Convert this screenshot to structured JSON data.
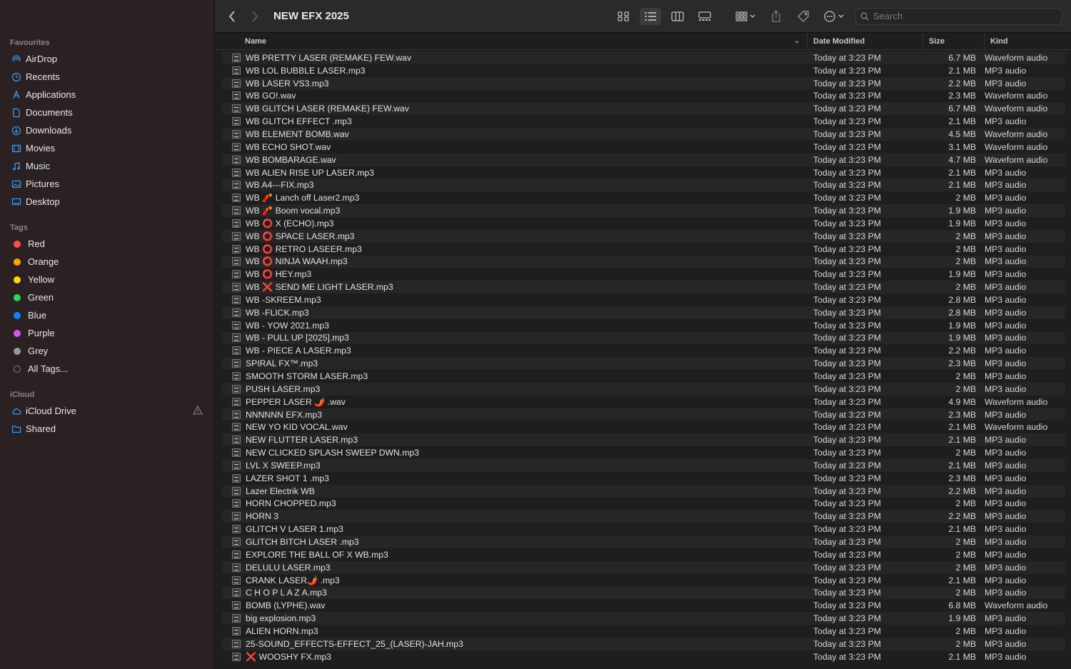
{
  "sidebar": {
    "favourites_label": "Favourites",
    "favourites": [
      {
        "label": "AirDrop",
        "icon": "airdrop-icon"
      },
      {
        "label": "Recents",
        "icon": "clock-icon"
      },
      {
        "label": "Applications",
        "icon": "applications-icon"
      },
      {
        "label": "Documents",
        "icon": "document-icon"
      },
      {
        "label": "Downloads",
        "icon": "download-icon"
      },
      {
        "label": "Movies",
        "icon": "film-icon"
      },
      {
        "label": "Music",
        "icon": "music-note-icon"
      },
      {
        "label": "Pictures",
        "icon": "picture-icon"
      },
      {
        "label": "Desktop",
        "icon": "desktop-icon"
      }
    ],
    "tags_label": "Tags",
    "tags": [
      {
        "label": "Red",
        "color": "#ff4d4d"
      },
      {
        "label": "Orange",
        "color": "#ff9f0a"
      },
      {
        "label": "Yellow",
        "color": "#ffd60a"
      },
      {
        "label": "Green",
        "color": "#30d158"
      },
      {
        "label": "Blue",
        "color": "#0a84ff"
      },
      {
        "label": "Purple",
        "color": "#d554f0"
      },
      {
        "label": "Grey",
        "color": "#98989d"
      },
      {
        "label": "All Tags...",
        "color": ""
      }
    ],
    "icloud_label": "iCloud",
    "icloud": [
      {
        "label": "iCloud Drive",
        "icon": "cloud-icon"
      },
      {
        "label": "Shared",
        "icon": "shared-folder-icon"
      }
    ],
    "accent_color": "#3b9cf5"
  },
  "toolbar": {
    "title": "NEW EFX 2025",
    "search_placeholder": "Search"
  },
  "table": {
    "headers": {
      "name": "Name",
      "date": "Date Modified",
      "size": "Size",
      "kind": "Kind"
    },
    "rows": [
      {
        "name": "WB PRETTY  LASER (REMAKE) FEW.wav",
        "date": "Today at 3:23 PM",
        "size": "6.7 MB",
        "kind": "Waveform audio"
      },
      {
        "name": "WB LOL BUBBLE LASER.mp3",
        "date": "Today at 3:23 PM",
        "size": "2.1 MB",
        "kind": "MP3 audio"
      },
      {
        "name": "WB LASER VS3.mp3",
        "date": "Today at 3:23 PM",
        "size": "2.2 MB",
        "kind": "MP3 audio"
      },
      {
        "name": "WB GO!.wav",
        "date": "Today at 3:23 PM",
        "size": "2.3 MB",
        "kind": "Waveform audio"
      },
      {
        "name": "WB GLITCH LASER (REMAKE) FEW.wav",
        "date": "Today at 3:23 PM",
        "size": "6.7 MB",
        "kind": "Waveform audio"
      },
      {
        "name": "WB GLITCH EFFECT .mp3",
        "date": "Today at 3:23 PM",
        "size": "2.1 MB",
        "kind": "MP3 audio"
      },
      {
        "name": "WB ELEMENT BOMB.wav",
        "date": "Today at 3:23 PM",
        "size": "4.5 MB",
        "kind": "Waveform audio"
      },
      {
        "name": "WB ECHO SHOT.wav",
        "date": "Today at 3:23 PM",
        "size": "3.1 MB",
        "kind": "Waveform audio"
      },
      {
        "name": "WB BOMBARAGE.wav",
        "date": "Today at 3:23 PM",
        "size": "4.7 MB",
        "kind": "Waveform audio"
      },
      {
        "name": "WB ALIEN RISE UP LASER.mp3",
        "date": "Today at 3:23 PM",
        "size": "2.1 MB",
        "kind": "MP3 audio"
      },
      {
        "name": "WB A4---FIX.mp3",
        "date": "Today at 3:23 PM",
        "size": "2.1 MB",
        "kind": "MP3 audio"
      },
      {
        "name": "WB 🧨 Lanch off Laser2.mp3",
        "date": "Today at 3:23 PM",
        "size": "2 MB",
        "kind": "MP3 audio"
      },
      {
        "name": "WB 🧨 Boom vocal.mp3",
        "date": "Today at 3:23 PM",
        "size": "1.9 MB",
        "kind": "MP3 audio"
      },
      {
        "name": "WB ⭕ X (ECHO).mp3",
        "date": "Today at 3:23 PM",
        "size": "1.9 MB",
        "kind": "MP3 audio"
      },
      {
        "name": "WB ⭕ SPACE LASER.mp3",
        "date": "Today at 3:23 PM",
        "size": "2 MB",
        "kind": "MP3 audio"
      },
      {
        "name": "WB ⭕ RETRO LASEER.mp3",
        "date": "Today at 3:23 PM",
        "size": "2 MB",
        "kind": "MP3 audio"
      },
      {
        "name": "WB ⭕ NINJA WAAH.mp3",
        "date": "Today at 3:23 PM",
        "size": "2 MB",
        "kind": "MP3 audio"
      },
      {
        "name": "WB ⭕ HEY.mp3",
        "date": "Today at 3:23 PM",
        "size": "1.9 MB",
        "kind": "MP3 audio"
      },
      {
        "name": "WB ❌ SEND ME LIGHT LASER.mp3",
        "date": "Today at 3:23 PM",
        "size": "2 MB",
        "kind": "MP3 audio"
      },
      {
        "name": "WB -SKREEM.mp3",
        "date": "Today at 3:23 PM",
        "size": "2.8 MB",
        "kind": "MP3 audio"
      },
      {
        "name": "WB -FLICK.mp3",
        "date": "Today at 3:23 PM",
        "size": "2.8 MB",
        "kind": "MP3 audio"
      },
      {
        "name": "WB - YOW 2021.mp3",
        "date": "Today at 3:23 PM",
        "size": "1.9 MB",
        "kind": "MP3 audio"
      },
      {
        "name": "WB - PULL UP [2025].mp3",
        "date": "Today at 3:23 PM",
        "size": "1.9 MB",
        "kind": "MP3 audio"
      },
      {
        "name": "WB - PIECE A LASER.mp3",
        "date": "Today at 3:23 PM",
        "size": "2.2 MB",
        "kind": "MP3 audio"
      },
      {
        "name": "SPIRAL FX™.mp3",
        "date": "Today at 3:23 PM",
        "size": "2.3 MB",
        "kind": "MP3 audio"
      },
      {
        "name": "SMOOTH STORM LASER.mp3",
        "date": "Today at 3:23 PM",
        "size": "2 MB",
        "kind": "MP3 audio"
      },
      {
        "name": "PUSH LASER.mp3",
        "date": "Today at 3:23 PM",
        "size": "2 MB",
        "kind": "MP3 audio"
      },
      {
        "name": "PEPPER LASER 🌶️ .wav",
        "date": "Today at 3:23 PM",
        "size": "4.9 MB",
        "kind": "Waveform audio"
      },
      {
        "name": "NNNNNN EFX.mp3",
        "date": "Today at 3:23 PM",
        "size": "2.3 MB",
        "kind": "MP3 audio"
      },
      {
        "name": "NEW YO KID VOCAL.wav",
        "date": "Today at 3:23 PM",
        "size": "2.1 MB",
        "kind": "Waveform audio"
      },
      {
        "name": "NEW FLUTTER LASER.mp3",
        "date": "Today at 3:23 PM",
        "size": "2.1 MB",
        "kind": "MP3 audio"
      },
      {
        "name": "NEW CLICKED SPLASH SWEEP DWN.mp3",
        "date": "Today at 3:23 PM",
        "size": "2 MB",
        "kind": "MP3 audio"
      },
      {
        "name": "LVL X SWEEP.mp3",
        "date": "Today at 3:23 PM",
        "size": "2.1 MB",
        "kind": "MP3 audio"
      },
      {
        "name": "LAZER SHOT 1 .mp3",
        "date": "Today at 3:23 PM",
        "size": "2.3 MB",
        "kind": "MP3 audio"
      },
      {
        "name": "Lazer Electrik WB",
        "date": "Today at 3:23 PM",
        "size": "2.2 MB",
        "kind": "MP3 audio"
      },
      {
        "name": "HORN CHOPPED.mp3",
        "date": "Today at 3:23 PM",
        "size": "2 MB",
        "kind": "MP3 audio"
      },
      {
        "name": "HORN 3",
        "date": "Today at 3:23 PM",
        "size": "2.2 MB",
        "kind": "MP3 audio"
      },
      {
        "name": "GLITCH V LASER 1.mp3",
        "date": "Today at 3:23 PM",
        "size": "2.1 MB",
        "kind": "MP3 audio"
      },
      {
        "name": "GLITCH BITCH LASER .mp3",
        "date": "Today at 3:23 PM",
        "size": "2 MB",
        "kind": "MP3 audio"
      },
      {
        "name": "EXPLORE THE BALL OF X WB.mp3",
        "date": "Today at 3:23 PM",
        "size": "2 MB",
        "kind": "MP3 audio"
      },
      {
        "name": "DELULU LASER.mp3",
        "date": "Today at 3:23 PM",
        "size": "2 MB",
        "kind": "MP3 audio"
      },
      {
        "name": "CRANK LASER🌶️ .mp3",
        "date": "Today at 3:23 PM",
        "size": "2.1 MB",
        "kind": "MP3 audio"
      },
      {
        "name": "C H O P L A Z A.mp3",
        "date": "Today at 3:23 PM",
        "size": "2 MB",
        "kind": "MP3 audio"
      },
      {
        "name": "BOMB (LYPHE).wav",
        "date": "Today at 3:23 PM",
        "size": "6.8 MB",
        "kind": "Waveform audio"
      },
      {
        "name": "big explosion.mp3",
        "date": "Today at 3:23 PM",
        "size": "1.9 MB",
        "kind": "MP3 audio"
      },
      {
        "name": "ALIEN HORN.mp3",
        "date": "Today at 3:23 PM",
        "size": "2 MB",
        "kind": "MP3 audio"
      },
      {
        "name": "25-SOUND_EFFECTS-EFFECT_25_(LASER)-JAH.mp3",
        "date": "Today at 3:23 PM",
        "size": "2 MB",
        "kind": "MP3 audio"
      },
      {
        "name": "❌ WOOSHY FX.mp3",
        "date": "Today at 3:23 PM",
        "size": "2.1 MB",
        "kind": "MP3 audio"
      }
    ]
  }
}
